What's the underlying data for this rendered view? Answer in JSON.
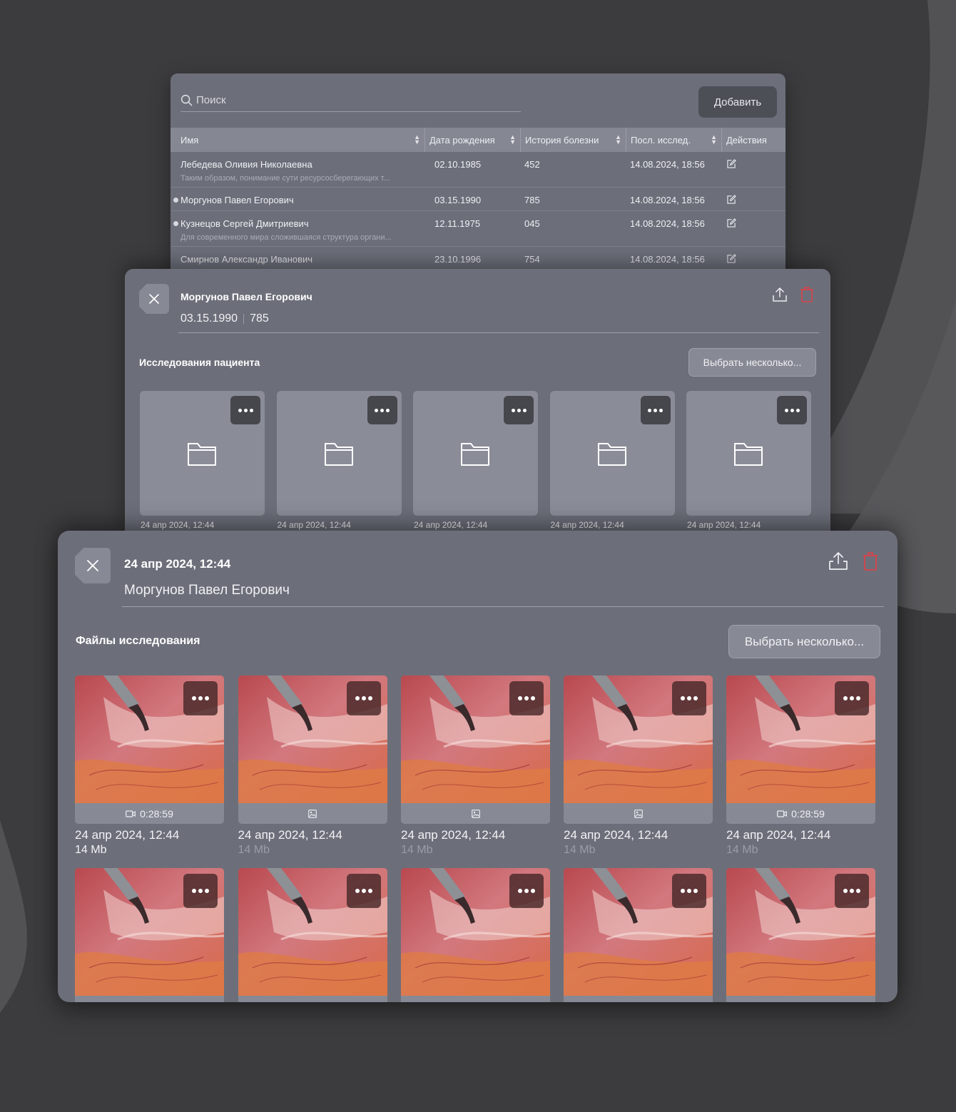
{
  "patients_table": {
    "search_placeholder": "Поиск",
    "add_button": "Добавить",
    "columns": [
      "Имя",
      "Дата рождения",
      "История болезни",
      "Посл. исслед.",
      "Действия"
    ],
    "rows": [
      {
        "name": "Лебедева Оливия Николаевна",
        "note": "Таким образом, понимание сути ресурсосберегающих т...",
        "birth_date": "02.10.1985",
        "history": "452",
        "last_study": "14.08.2024, 18:56",
        "marked": false
      },
      {
        "name": "Моргунов Павел Егорович",
        "note": "",
        "birth_date": "03.15.1990",
        "history": "785",
        "last_study": "14.08.2024, 18:56",
        "marked": true
      },
      {
        "name": "Кузнецов Сергей Дмитриевич",
        "note": "Для современного мира сложившаяся структура органи...",
        "birth_date": "12.11.1975",
        "history": "045",
        "last_study": "14.08.2024, 18:56",
        "marked": true
      },
      {
        "name": "Смирнов Александр Иванович",
        "note": "",
        "birth_date": "23.10.1996",
        "history": "754",
        "last_study": "14.08.2024, 18:56",
        "marked": false
      }
    ]
  },
  "patient_panel": {
    "name": "Моргунов Павел Егорович",
    "birth_date": "03.15.1990",
    "history": "785",
    "section_title": "Исследования пациента",
    "select_button": "Выбрать несколько...",
    "studies": [
      {
        "date": "24 апр 2024, 12:44"
      },
      {
        "date": "24 апр 2024, 12:44"
      },
      {
        "date": "24 апр 2024, 12:44"
      },
      {
        "date": "24 апр 2024, 12:44"
      },
      {
        "date": "24 апр 2024, 12:44"
      }
    ]
  },
  "files_panel": {
    "study_date": "24 апр 2024, 12:44",
    "patient_name": "Моргунов Павел Егорович",
    "section_title": "Файлы исследования",
    "select_button": "Выбрать несколько...",
    "files": [
      {
        "type": "video",
        "duration": "0:28:59",
        "date": "24 апр 2024, 12:44",
        "size": "14 Mb",
        "size_emphasis": true
      },
      {
        "type": "image",
        "duration": "",
        "date": "24 апр 2024, 12:44",
        "size": "14 Mb",
        "size_emphasis": false
      },
      {
        "type": "image",
        "duration": "",
        "date": "24 апр 2024, 12:44",
        "size": "14 Mb",
        "size_emphasis": false
      },
      {
        "type": "image",
        "duration": "",
        "date": "24 апр 2024, 12:44",
        "size": "14 Mb",
        "size_emphasis": false
      },
      {
        "type": "video",
        "duration": "0:28:59",
        "date": "24 апр 2024, 12:44",
        "size": "14 Mb",
        "size_emphasis": false
      }
    ],
    "second_row_count": 5
  },
  "colors": {
    "background": "#3c3c3e",
    "panel": "#6c6f7a",
    "delete_icon": "#d9434a",
    "accent_dark": "#46474d"
  }
}
